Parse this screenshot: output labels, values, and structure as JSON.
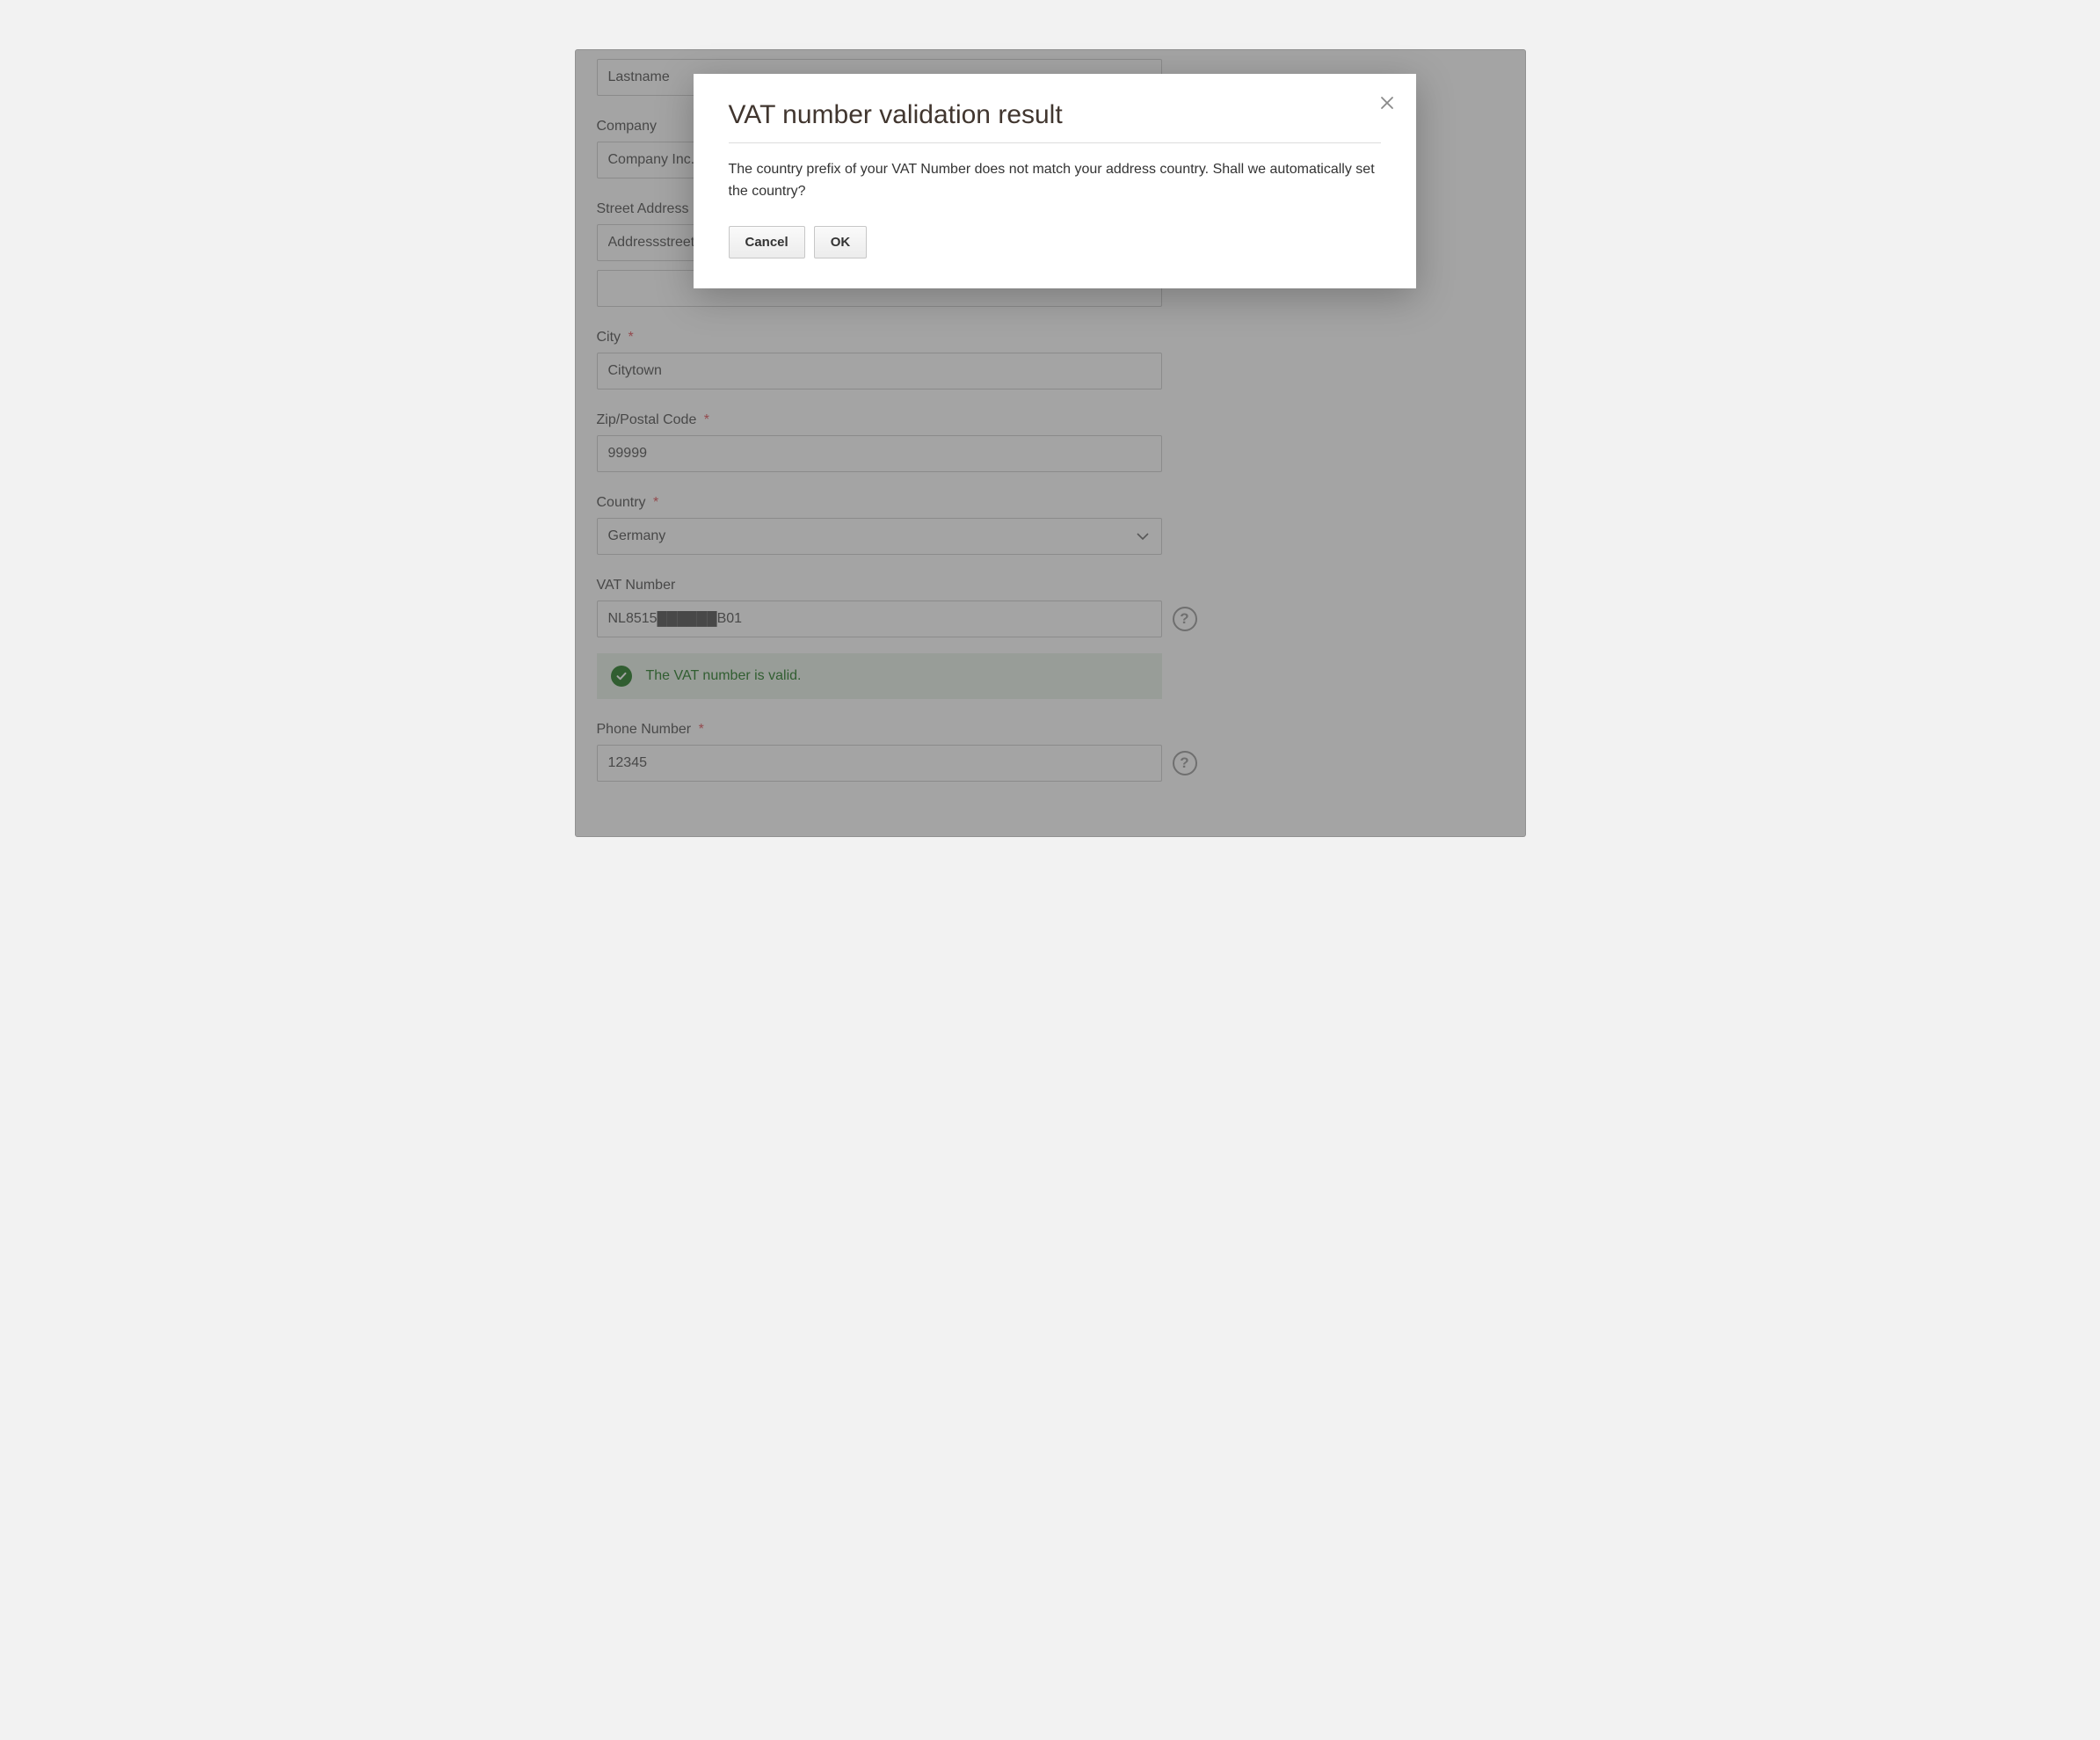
{
  "modal": {
    "title": "VAT number validation result",
    "body": "The country prefix of your VAT Number does not match your address country. Shall we automatically set the country?",
    "cancel": "Cancel",
    "ok": "OK"
  },
  "form": {
    "lastname_value": "Lastname",
    "company_label": "Company",
    "company_value": "Company Inc.",
    "street_label": "Street Address",
    "street_value_1": "Addressstreet",
    "street_value_2": "",
    "city_label": "City",
    "city_value": "Citytown",
    "zip_label": "Zip/Postal Code",
    "zip_value": "99999",
    "country_label": "Country",
    "country_value": "Germany",
    "vat_label": "VAT Number",
    "vat_value": "NL8515██████B01",
    "vat_valid_msg": "The VAT number is valid.",
    "phone_label": "Phone Number",
    "phone_value": "12345",
    "required_mark": "*",
    "help_glyph": "?"
  }
}
